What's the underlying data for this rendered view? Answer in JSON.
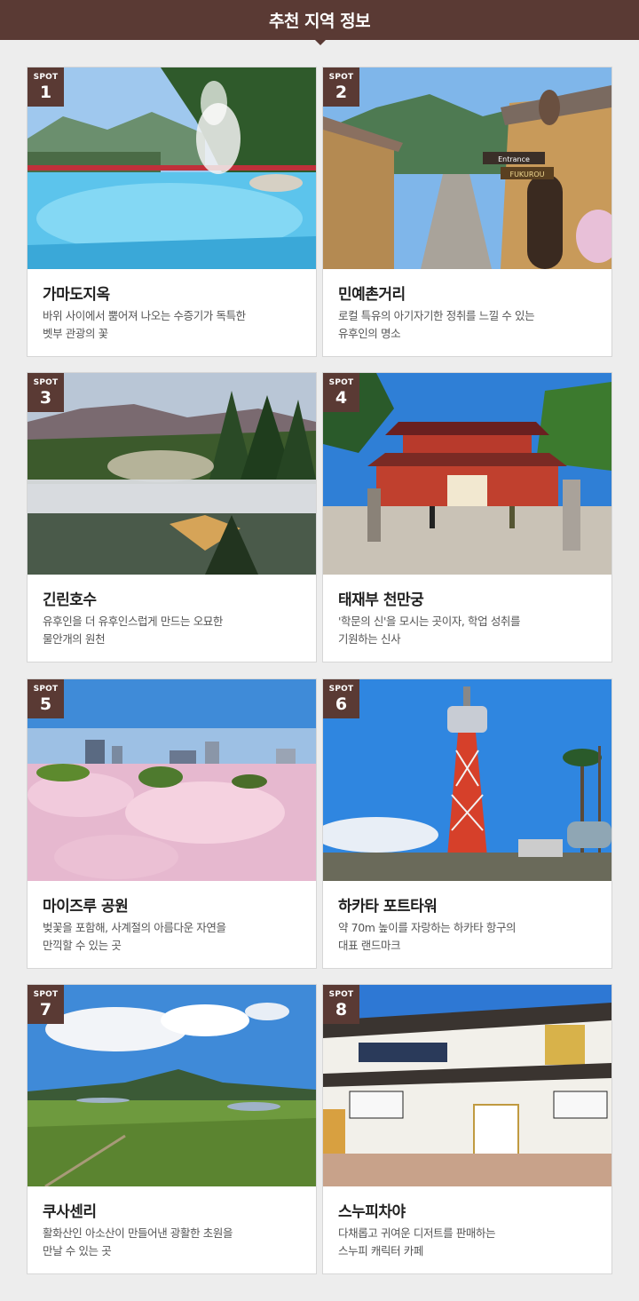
{
  "header": {
    "title": "추천 지역 정보"
  },
  "spot_label": "SPOT",
  "spots": [
    {
      "num": "1",
      "title": "가마도지옥",
      "desc1": "바위 사이에서 뿜어져 나오는 수증기가 독특한",
      "desc2": "벳부 관광의 꽃"
    },
    {
      "num": "2",
      "title": "민예촌거리",
      "desc1": "로컬 특유의 아기자기한 정취를 느낄 수 있는",
      "desc2": "유후인의 명소"
    },
    {
      "num": "3",
      "title": "긴린호수",
      "desc1": "유후인을 더 유후인스럽게 만드는 오묘한",
      "desc2": "물안개의 원천"
    },
    {
      "num": "4",
      "title": "태재부 천만궁",
      "desc1": "'학문의 신'을 모시는 곳이자, 학업 성취를",
      "desc2": "기원하는 신사"
    },
    {
      "num": "5",
      "title": "마이즈루 공원",
      "desc1": "벚꽃을 포함해, 사계절의 아름다운 자연을",
      "desc2": "만끽할 수 있는 곳"
    },
    {
      "num": "6",
      "title": "하카타 포트타워",
      "desc1": "약 70m 높이를 자랑하는 하카타 항구의",
      "desc2": "대표 랜드마크"
    },
    {
      "num": "7",
      "title": "쿠사센리",
      "desc1": "활화산인 아소산이 만들어낸 광활한 초원을",
      "desc2": "만날 수 있는 곳"
    },
    {
      "num": "8",
      "title": "스누피차야",
      "desc1": "다채롭고 귀여운 디저트를 판매하는",
      "desc2": "스누피 캐릭터 카페"
    }
  ],
  "sign_text": {
    "entrance": "Entrance",
    "fukurou": "FUKUROU"
  },
  "colors": {
    "header_bg": "#5a3a34",
    "badge_bg": "#5a3a34",
    "page_bg": "#ededed"
  }
}
